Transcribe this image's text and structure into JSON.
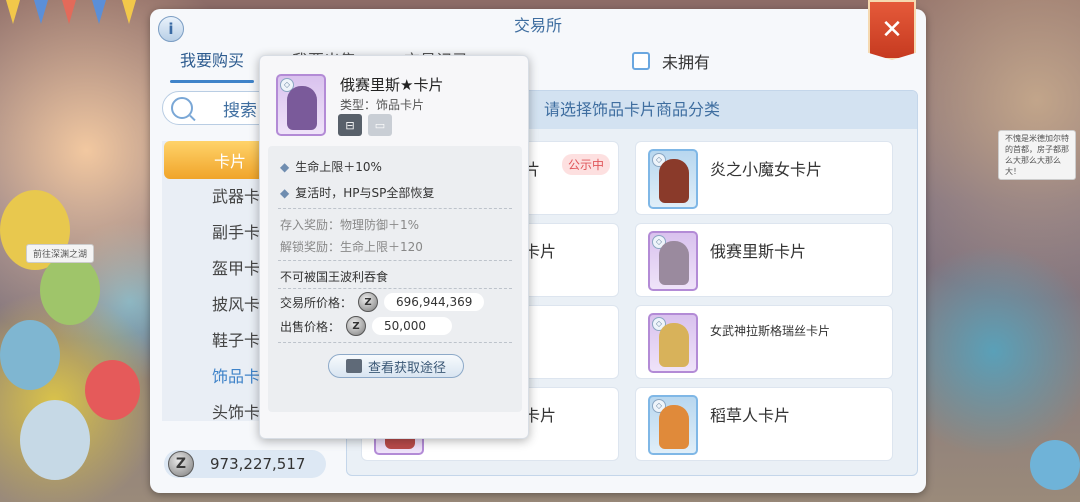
{
  "window": {
    "title": "交易所"
  },
  "tabs": [
    {
      "label": "我要购买",
      "active": true
    },
    {
      "label": "我要出售",
      "active": false
    },
    {
      "label": "交易记录",
      "active": false
    }
  ],
  "filter": {
    "unowned_label": "未拥有"
  },
  "search": {
    "label": "搜索"
  },
  "sidebar": {
    "header": "卡片",
    "items": [
      {
        "label": "武器卡片"
      },
      {
        "label": "副手卡片"
      },
      {
        "label": "盔甲卡片"
      },
      {
        "label": "披风卡片"
      },
      {
        "label": "鞋子卡片"
      },
      {
        "label": "饰品卡片",
        "active": true
      },
      {
        "label": "头饰卡片"
      }
    ]
  },
  "currency": {
    "balance": "973,227,517",
    "symbol": "Z"
  },
  "panel": {
    "header": "请选择饰品卡片商品分类",
    "cards": [
      {
        "name": "片",
        "tag": "公示中"
      },
      {
        "name": "炎之小魔女卡片"
      },
      {
        "name": "卡片"
      },
      {
        "name": "俄赛里斯卡片"
      },
      {
        "name": ""
      },
      {
        "name": "女武神拉斯格瑞丝卡片"
      },
      {
        "name": "卡片"
      },
      {
        "name": "稻草人卡片"
      }
    ]
  },
  "tooltip": {
    "title": "俄赛里斯★卡片",
    "type": "类型：饰品卡片",
    "effects": [
      "生命上限＋10%",
      "复活时，HP与SP全部恢复"
    ],
    "deposit_reward": "存入奖励：物理防御＋1%",
    "unlock_reward": "解锁奖励：生命上限＋120",
    "note": "不可被国王波利吞食",
    "exchange_price_label": "交易所价格：",
    "exchange_price": "696,944,369",
    "sell_price_label": "出售价格：",
    "sell_price": "50,000",
    "view_source_label": "查看获取途径"
  },
  "background": {
    "sign_left": "前往深渊之湖",
    "sign_right": "不愧是米德加尔特的首都，房子都那么大那么大那么大！"
  },
  "colors": {
    "accent_blue": "#3f83c9",
    "close_red": "#d4452a",
    "sidebar_active": "#f0a42a",
    "tag_red": "#e0565a"
  }
}
